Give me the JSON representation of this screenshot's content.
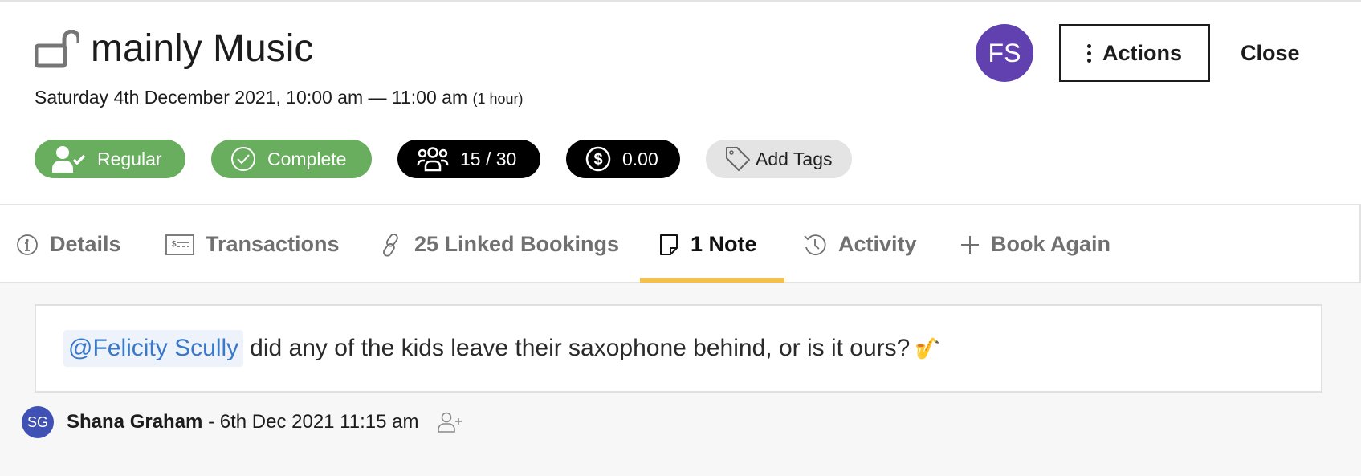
{
  "header": {
    "title": "mainly Music",
    "lock_icon": "unlocked-padlock-icon",
    "date_range": "Saturday 4th December 2021, 10:00 am — 11:00 am",
    "duration": "(1 hour)",
    "badges": {
      "regular": {
        "label": "Regular",
        "icon": "user-check-icon",
        "color": "#68ae5e"
      },
      "complete": {
        "label": "Complete",
        "icon": "check-circle-icon",
        "color": "#68ae5e"
      },
      "attendees": {
        "label": "15 / 30",
        "icon": "group-icon",
        "color": "#000000"
      },
      "balance": {
        "label": "0.00",
        "icon": "dollar-circle-icon",
        "color": "#000000"
      },
      "tags": {
        "label": "Add Tags",
        "icon": "tag-icon",
        "color": "#e4e4e4"
      }
    },
    "user_avatar": {
      "initials": "FS",
      "color": "#6140b0"
    },
    "actions_label": "Actions",
    "close_label": "Close"
  },
  "tabs": [
    {
      "label": "Details",
      "icon": "info-icon",
      "active": false
    },
    {
      "label": "Transactions",
      "icon": "receipt-icon",
      "active": false
    },
    {
      "label": "25 Linked Bookings",
      "icon": "link-icon",
      "active": false
    },
    {
      "label": "1 Note",
      "icon": "note-icon",
      "active": true
    },
    {
      "label": "Activity",
      "icon": "history-icon",
      "active": false
    },
    {
      "label": "Book Again",
      "icon": "plus-icon",
      "active": false
    }
  ],
  "active_tab_color": "#f5c04a",
  "note": {
    "mention": "@Felicity Scully",
    "text": "did any of the kids leave their saxophone behind, or is it ours?",
    "emoji": "🎷",
    "author_initials": "SG",
    "author_color": "#3f51b5",
    "author_name": "Shana Graham",
    "timestamp": "- 6th Dec 2021 11:15 am"
  }
}
